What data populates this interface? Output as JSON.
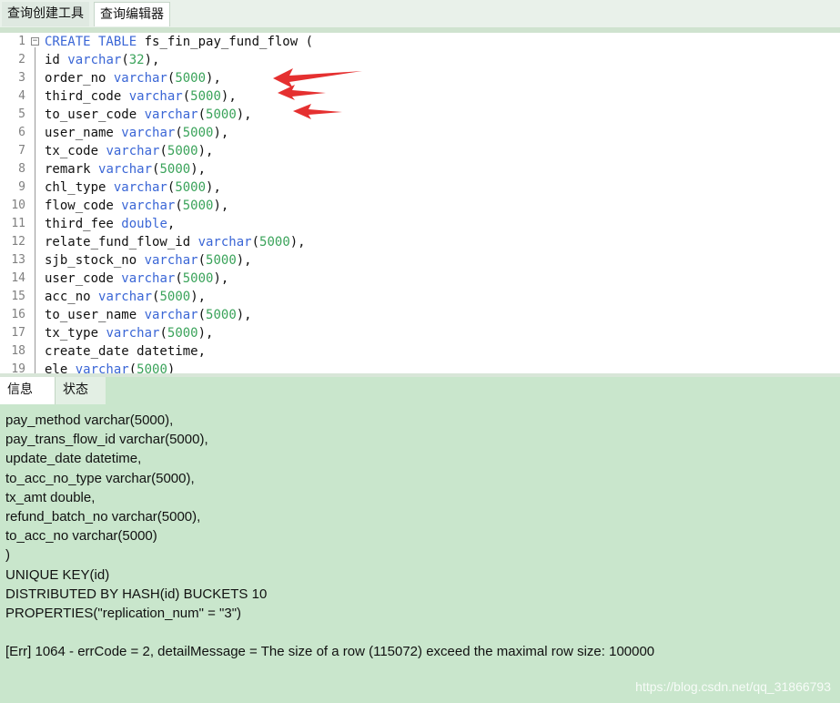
{
  "tabs": [
    {
      "label": "查询创建工具",
      "active": false
    },
    {
      "label": "查询编辑器",
      "active": true
    }
  ],
  "editor": {
    "lines": [
      {
        "n": "1",
        "parts": [
          [
            "kw",
            "CREATE TABLE"
          ],
          [
            "ident",
            " fs_fin_pay_fund_flow ("
          ]
        ]
      },
      {
        "n": "2",
        "parts": [
          [
            "ident",
            "id "
          ],
          [
            "kw",
            "varchar"
          ],
          [
            "ident",
            "("
          ],
          [
            "num",
            "32"
          ],
          [
            "ident",
            "),"
          ]
        ]
      },
      {
        "n": "3",
        "parts": [
          [
            "ident",
            "order_no "
          ],
          [
            "kw",
            "varchar"
          ],
          [
            "ident",
            "("
          ],
          [
            "num",
            "5000"
          ],
          [
            "ident",
            "),"
          ]
        ]
      },
      {
        "n": "4",
        "parts": [
          [
            "ident",
            "third_code "
          ],
          [
            "kw",
            "varchar"
          ],
          [
            "ident",
            "("
          ],
          [
            "num",
            "5000"
          ],
          [
            "ident",
            "),"
          ]
        ]
      },
      {
        "n": "5",
        "parts": [
          [
            "ident",
            "to_user_code "
          ],
          [
            "kw",
            "varchar"
          ],
          [
            "ident",
            "("
          ],
          [
            "num",
            "5000"
          ],
          [
            "ident",
            "),"
          ]
        ]
      },
      {
        "n": "6",
        "parts": [
          [
            "ident",
            "user_name "
          ],
          [
            "kw",
            "varchar"
          ],
          [
            "ident",
            "("
          ],
          [
            "num",
            "5000"
          ],
          [
            "ident",
            "),"
          ]
        ]
      },
      {
        "n": "7",
        "parts": [
          [
            "ident",
            "tx_code "
          ],
          [
            "kw",
            "varchar"
          ],
          [
            "ident",
            "("
          ],
          [
            "num",
            "5000"
          ],
          [
            "ident",
            "),"
          ]
        ]
      },
      {
        "n": "8",
        "parts": [
          [
            "ident",
            "remark "
          ],
          [
            "kw",
            "varchar"
          ],
          [
            "ident",
            "("
          ],
          [
            "num",
            "5000"
          ],
          [
            "ident",
            "),"
          ]
        ]
      },
      {
        "n": "9",
        "parts": [
          [
            "ident",
            "chl_type "
          ],
          [
            "kw",
            "varchar"
          ],
          [
            "ident",
            "("
          ],
          [
            "num",
            "5000"
          ],
          [
            "ident",
            "),"
          ]
        ]
      },
      {
        "n": "10",
        "parts": [
          [
            "ident",
            "flow_code "
          ],
          [
            "kw",
            "varchar"
          ],
          [
            "ident",
            "("
          ],
          [
            "num",
            "5000"
          ],
          [
            "ident",
            "),"
          ]
        ]
      },
      {
        "n": "11",
        "parts": [
          [
            "ident",
            "third_fee "
          ],
          [
            "kw",
            "double"
          ],
          [
            "ident",
            ","
          ]
        ]
      },
      {
        "n": "12",
        "parts": [
          [
            "ident",
            "relate_fund_flow_id "
          ],
          [
            "kw",
            "varchar"
          ],
          [
            "ident",
            "("
          ],
          [
            "num",
            "5000"
          ],
          [
            "ident",
            "),"
          ]
        ]
      },
      {
        "n": "13",
        "parts": [
          [
            "ident",
            "sjb_stock_no "
          ],
          [
            "kw",
            "varchar"
          ],
          [
            "ident",
            "("
          ],
          [
            "num",
            "5000"
          ],
          [
            "ident",
            "),"
          ]
        ]
      },
      {
        "n": "14",
        "parts": [
          [
            "ident",
            "user_code "
          ],
          [
            "kw",
            "varchar"
          ],
          [
            "ident",
            "("
          ],
          [
            "num",
            "5000"
          ],
          [
            "ident",
            "),"
          ]
        ]
      },
      {
        "n": "15",
        "parts": [
          [
            "ident",
            "acc_no "
          ],
          [
            "kw",
            "varchar"
          ],
          [
            "ident",
            "("
          ],
          [
            "num",
            "5000"
          ],
          [
            "ident",
            "),"
          ]
        ]
      },
      {
        "n": "16",
        "parts": [
          [
            "ident",
            "to_user_name "
          ],
          [
            "kw",
            "varchar"
          ],
          [
            "ident",
            "("
          ],
          [
            "num",
            "5000"
          ],
          [
            "ident",
            "),"
          ]
        ]
      },
      {
        "n": "17",
        "parts": [
          [
            "ident",
            "tx_type "
          ],
          [
            "kw",
            "varchar"
          ],
          [
            "ident",
            "("
          ],
          [
            "num",
            "5000"
          ],
          [
            "ident",
            "),"
          ]
        ]
      },
      {
        "n": "18",
        "parts": [
          [
            "ident",
            "create_date datetime,"
          ]
        ]
      },
      {
        "n": "19",
        "parts": [
          [
            "ident",
            "ele "
          ],
          [
            "kw",
            "varchar"
          ],
          [
            "ident",
            "("
          ],
          [
            "num",
            "5000"
          ],
          [
            "ident",
            ")"
          ]
        ]
      }
    ]
  },
  "bottom_tabs": [
    {
      "label": "信息",
      "active": true
    },
    {
      "label": "状态",
      "active": false
    }
  ],
  "messages": [
    "pay_method varchar(5000),",
    "pay_trans_flow_id varchar(5000),",
    "update_date datetime,",
    "to_acc_no_type varchar(5000),",
    "tx_amt double,",
    "refund_batch_no varchar(5000),",
    "to_acc_no varchar(5000)",
    ")",
    "UNIQUE KEY(id)",
    "DISTRIBUTED BY HASH(id) BUCKETS 10",
    "PROPERTIES(\"replication_num\" = \"3\")",
    "",
    "[Err] 1064 - errCode = 2, detailMessage = The size of a row (115072) exceed the maximal row size: 100000"
  ],
  "watermark": "https://blog.csdn.net/qq_31866793",
  "colors": {
    "keyword": "#3a66d6",
    "number": "#3aa35a",
    "panel_bg": "#c9e6cc",
    "arrow": "#e53030"
  },
  "annotations": [
    {
      "type": "arrow",
      "points_to_line": 3
    },
    {
      "type": "arrow",
      "points_to_line": 4
    },
    {
      "type": "arrow",
      "points_to_line": 5
    }
  ]
}
